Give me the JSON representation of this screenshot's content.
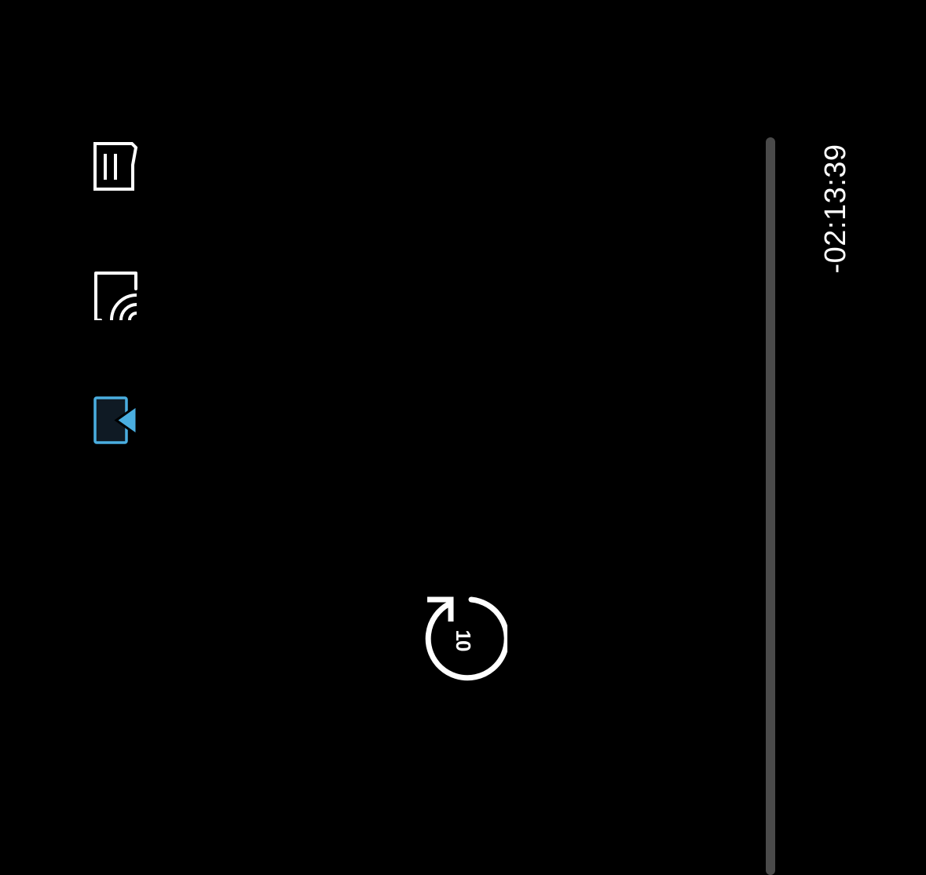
{
  "player": {
    "time_remaining": "-02:13:39",
    "rewind": {
      "seconds_label": "10",
      "icon": "rewind-10-icon"
    },
    "progress": {
      "fraction_played": 0
    }
  },
  "side_controls": [
    {
      "icon": "subtitles-icon",
      "active": false
    },
    {
      "icon": "cast-icon",
      "active": false
    },
    {
      "icon": "episodes-icon",
      "active": true
    }
  ],
  "colors": {
    "background": "#000000",
    "icon": "#ffffff",
    "accent": "#4aaee0",
    "accent_fill": "#0f1a24",
    "track": "#4a4a4a"
  }
}
